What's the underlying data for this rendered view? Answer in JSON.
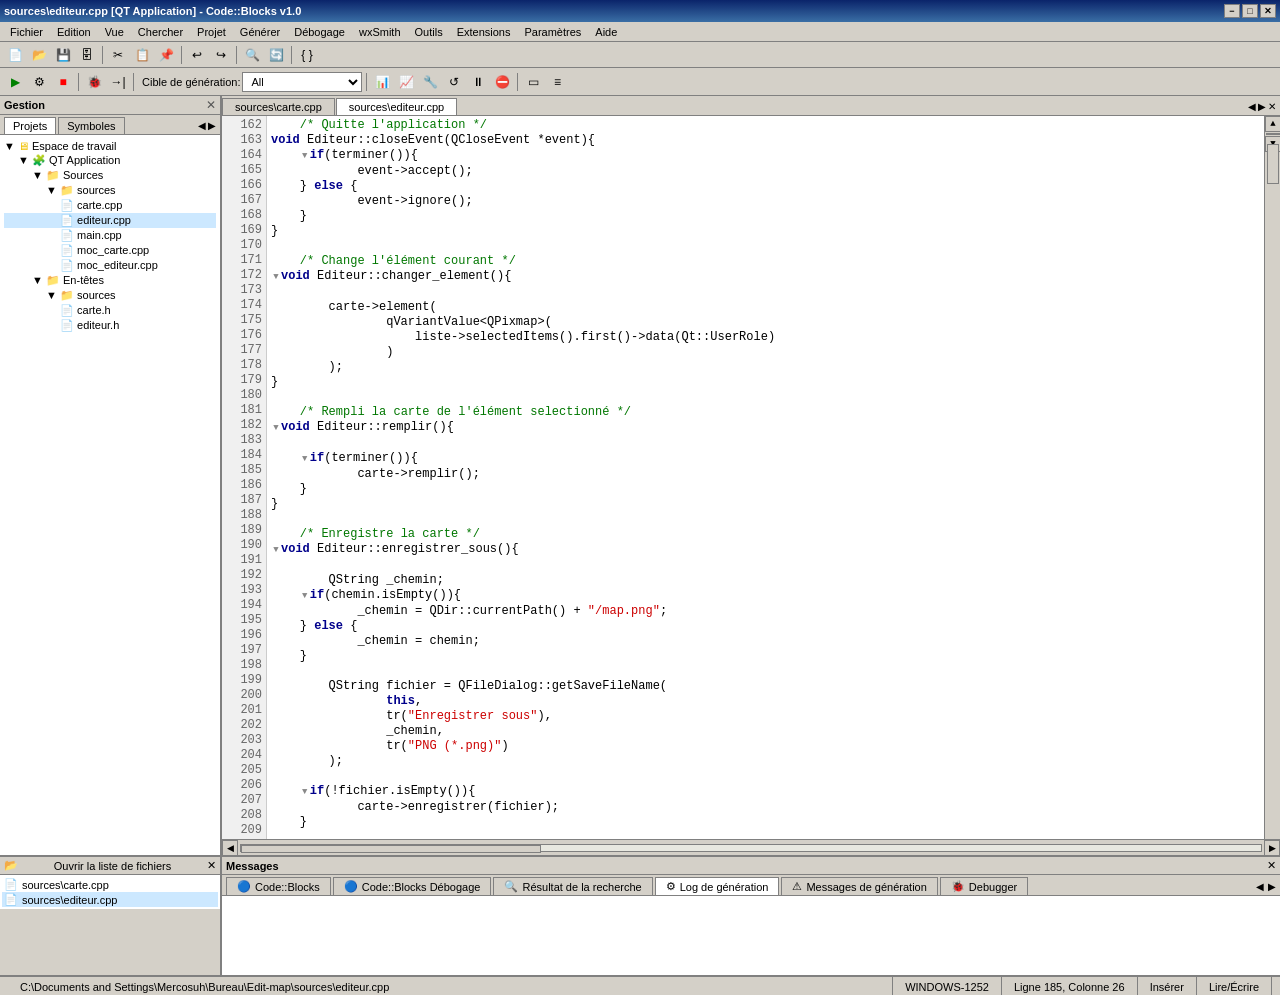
{
  "titlebar": {
    "title": "sources\\editeur.cpp [QT Application] - Code::Blocks v1.0",
    "min": "−",
    "max": "□",
    "close": "✕"
  },
  "menubar": {
    "items": [
      "Fichier",
      "Edition",
      "Vue",
      "Chercher",
      "Projet",
      "Générer",
      "Débogage",
      "wxSmith",
      "Outils",
      "Extensions",
      "Paramètres",
      "Aide"
    ]
  },
  "toolbar2": {
    "build_label": "Cible de génération:",
    "build_value": "All"
  },
  "left_panel": {
    "title": "Gestion",
    "tabs": [
      "Projets",
      "Symboles"
    ],
    "tree": {
      "workspace": "Espace de travail",
      "project": "QT Application",
      "sources_folder": "Sources",
      "sources_sub": "sources",
      "files": [
        "carte.cpp",
        "editeur.cpp",
        "main.cpp",
        "moc_carte.cpp",
        "moc_editeur.cpp"
      ],
      "headers_folder": "En-têtes",
      "headers_sub": "sources",
      "header_files": [
        "carte.h",
        "editeur.h"
      ]
    }
  },
  "opened_files": {
    "title": "Ouvrir la liste de fichiers",
    "files": [
      "sources\\carte.cpp",
      "sources\\editeur.cpp"
    ]
  },
  "editor": {
    "tabs": [
      "sources\\carte.cpp",
      "sources\\editeur.cpp"
    ],
    "active_tab": "sources\\editeur.cpp"
  },
  "messages": {
    "title": "Messages",
    "tabs": [
      "Code::Blocks",
      "Code::Blocks Débogage",
      "Résultat de la recherche",
      "Log de génération",
      "Messages de génération",
      "Debugger"
    ],
    "active_tab": "Log de génération"
  },
  "statusbar": {
    "path": "C:\\Documents and Settings\\Mercosuh\\Bureau\\Edit-map\\sources\\editeur.cpp",
    "encoding": "WINDOWS-1252",
    "position": "Ligne 185, Colonne 26",
    "insert_mode": "Insérer",
    "rw_mode": "Lire/Écrire"
  }
}
